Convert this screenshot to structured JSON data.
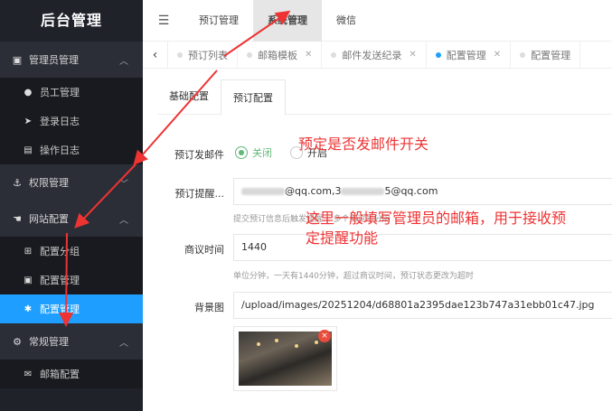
{
  "sidebar": {
    "brand": "后台管理",
    "groups": [
      {
        "label": "管理员管理",
        "icon": "id-card-icon",
        "chev": "︿"
      },
      {
        "label": "权限管理",
        "icon": "anchor-icon",
        "chev": "﹀"
      },
      {
        "label": "网站配置",
        "icon": "hand-icon",
        "chev": "︿"
      },
      {
        "label": "常规管理",
        "icon": "cogs-icon",
        "chev": "︿"
      }
    ],
    "items": [
      {
        "label": "员工管理",
        "icon": "user-icon"
      },
      {
        "label": "登录日志",
        "icon": "send-icon"
      },
      {
        "label": "操作日志",
        "icon": "list-icon"
      },
      {
        "label": "配置分组",
        "icon": "group-icon"
      },
      {
        "label": "配置管理",
        "icon": "image-icon"
      },
      {
        "label": "配置管理",
        "icon": "asterisk-icon"
      },
      {
        "label": "邮箱配置",
        "icon": "mail-icon"
      }
    ]
  },
  "topbar": {
    "menu_icon": "☰",
    "tabs": [
      "预订管理",
      "系统管理",
      "微信"
    ]
  },
  "page_tabs": {
    "prev": "‹",
    "items": [
      "预订列表",
      "邮箱模板",
      "邮件发送纪录",
      "配置管理",
      "配置管理"
    ],
    "close": "✕"
  },
  "subtabs": [
    "基础配置",
    "预订配置"
  ],
  "form": {
    "send_mail_label": "预订发邮件",
    "radio_off": "关闭",
    "radio_on": "开启",
    "remind_label": "预订提醒...",
    "remind_value_a": "@qq.com,3",
    "remind_value_b": "5@qq.com",
    "remind_hint": "提交预订信息后触发提醒... 多个用逗号分隔",
    "negotiate_label": "商议时间",
    "negotiate_value": "1440",
    "negotiate_hint": "单位分钟，一天有1440分钟，超过商议时间，预订状态更改为超时",
    "bg_label": "背景图",
    "bg_value": "/upload/images/20251204/d68801a2395dae123b747a31ebb01c47.jpg",
    "delete_mark": "×"
  },
  "annotations": {
    "note1": "预定是否发邮件开关",
    "note2_line1": "这里一般填写管理员的邮箱，用于接收预",
    "note2_line2": "定提醒功能"
  },
  "colors": {
    "accent": "#1e9fff",
    "sidebar": "#20222a",
    "annotation": "#ee3333",
    "radio": "#5fb878"
  }
}
